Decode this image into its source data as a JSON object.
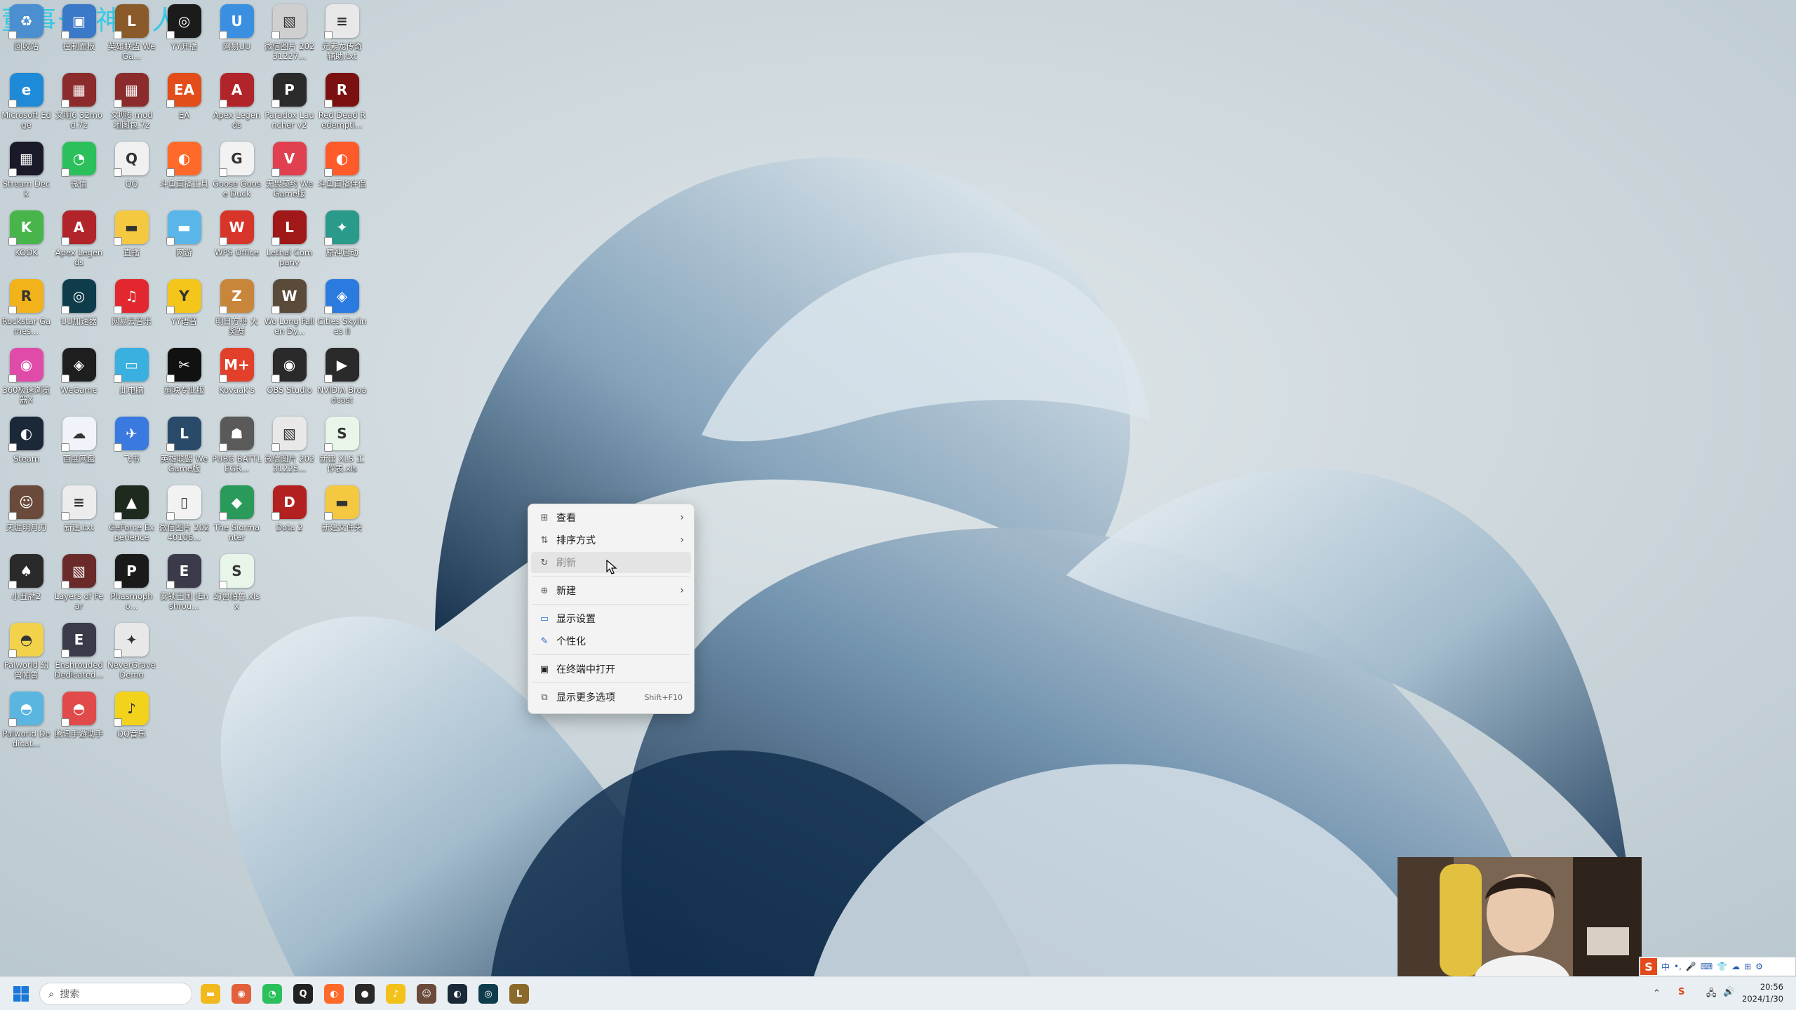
{
  "watermark": {
    "text": "董事长 神秘人"
  },
  "desktop": {
    "icons": [
      {
        "label": "回收站",
        "glyph": "♻",
        "color": "#4b8fd1"
      },
      {
        "label": "控制面板",
        "glyph": "▣",
        "color": "#3a78c8"
      },
      {
        "label": "英雄联盟 WeGa...",
        "glyph": "L",
        "color": "#8a5a2a"
      },
      {
        "label": "YY开播",
        "glyph": "◎",
        "color": "#1b1b1b"
      },
      {
        "label": "网易UU",
        "glyph": "U",
        "color": "#3a8fe0"
      },
      {
        "label": "微信图片 20231227...",
        "glyph": "▧",
        "color": "#cfcfcf"
      },
      {
        "label": "元素龙传奇 辅助.txt",
        "glyph": "≡",
        "color": "#e8e8e8"
      },
      {
        "label": "Microsoft Edge",
        "glyph": "e",
        "color": "#1f8ad8"
      },
      {
        "label": "文明6 32mod.7z",
        "glyph": "▦",
        "color": "#8b2b2b"
      },
      {
        "label": "文明6 mod 地图包.7z",
        "glyph": "▦",
        "color": "#8b2b2b"
      },
      {
        "label": "EA",
        "glyph": "EA",
        "color": "#e24d1a"
      },
      {
        "label": "Apex Legends",
        "glyph": "A",
        "color": "#b0242a"
      },
      {
        "label": "Paradox Launcher v2",
        "glyph": "P",
        "color": "#2b2b2b"
      },
      {
        "label": "Red Dead Redempti...",
        "glyph": "R",
        "color": "#7a1010"
      },
      {
        "label": "Stream Deck",
        "glyph": "▦",
        "color": "#1a1a2a"
      },
      {
        "label": "微信",
        "glyph": "◔",
        "color": "#2cc05c"
      },
      {
        "label": "QQ",
        "glyph": "Q",
        "color": "#f0f0f0"
      },
      {
        "label": "斗鱼直播工具",
        "glyph": "◐",
        "color": "#ff6a2a"
      },
      {
        "label": "Goose Goose Duck",
        "glyph": "G",
        "color": "#f2f2f2"
      },
      {
        "label": "无畏契约 WeGame版",
        "glyph": "V",
        "color": "#e04050"
      },
      {
        "label": "斗鱼直播伴侣",
        "glyph": "◐",
        "color": "#ff5a2a"
      },
      {
        "label": "KOOK",
        "glyph": "K",
        "color": "#47b54a"
      },
      {
        "label": "Apex Legends",
        "glyph": "A",
        "color": "#b0242a"
      },
      {
        "label": "直播",
        "glyph": "▬",
        "color": "#f5c842"
      },
      {
        "label": "网游",
        "glyph": "▬",
        "color": "#5ab6e8"
      },
      {
        "label": "WPS Office",
        "glyph": "W",
        "color": "#d8352a"
      },
      {
        "label": "Lethal Company",
        "glyph": "L",
        "color": "#a01818"
      },
      {
        "label": "原神启动",
        "glyph": "✦",
        "color": "#2a9a8a"
      },
      {
        "label": "Rockstar Games...",
        "glyph": "R",
        "color": "#f2b21b"
      },
      {
        "label": "UU加速器",
        "glyph": "◎",
        "color": "#0e3c4a"
      },
      {
        "label": "网易云音乐",
        "glyph": "♫",
        "color": "#e2282e"
      },
      {
        "label": "YY语音",
        "glyph": "Y",
        "color": "#f4c51a"
      },
      {
        "label": "明日方舟 大奖赛",
        "glyph": "Z",
        "color": "#c8863a"
      },
      {
        "label": "Wo Long Fallen Dy...",
        "glyph": "W",
        "color": "#5a4a3a"
      },
      {
        "label": "Cities Skylines II",
        "glyph": "◈",
        "color": "#2a7ae0"
      },
      {
        "label": "360极速浏览器X",
        "glyph": "◉",
        "color": "#e04aa8"
      },
      {
        "label": "WeGame",
        "glyph": "◈",
        "color": "#1e1e1e"
      },
      {
        "label": "此电脑",
        "glyph": "▭",
        "color": "#3ab0e0"
      },
      {
        "label": "剪映专业版",
        "glyph": "✂",
        "color": "#111111"
      },
      {
        "label": "Kovaak's",
        "glyph": "M+",
        "color": "#e2402a"
      },
      {
        "label": "OBS Studio",
        "glyph": "◉",
        "color": "#2a2a2a"
      },
      {
        "label": "NVIDIA Broadcast",
        "glyph": "▶",
        "color": "#2a2a2a"
      },
      {
        "label": "Steam",
        "glyph": "◐",
        "color": "#1b2838"
      },
      {
        "label": "百度网盘",
        "glyph": "☁",
        "color": "#f0f4fa"
      },
      {
        "label": "飞书",
        "glyph": "✈",
        "color": "#3a7ae0"
      },
      {
        "label": "英雄联盟 WeGame版",
        "glyph": "L",
        "color": "#2a4a6a"
      },
      {
        "label": "PUBG BATTLEGR...",
        "glyph": "☗",
        "color": "#5a5a5a"
      },
      {
        "label": "微信图片 20231225...",
        "glyph": "▧",
        "color": "#e8e8e8"
      },
      {
        "label": "新建 XLS 工作表.xls",
        "glyph": "S",
        "color": "#e8f6ea"
      },
      {
        "label": "天涯明月刀",
        "glyph": "☺",
        "color": "#6a4a3a"
      },
      {
        "label": "新建.txt",
        "glyph": "≡",
        "color": "#ececec"
      },
      {
        "label": "GeForce Experience",
        "glyph": "▲",
        "color": "#1f2a1f"
      },
      {
        "label": "微信图片 20240106...",
        "glyph": "▯",
        "color": "#f2f2f2"
      },
      {
        "label": "The Siormanter",
        "glyph": "◆",
        "color": "#2a9a5a"
      },
      {
        "label": "Dota 2",
        "glyph": "D",
        "color": "#b22020"
      },
      {
        "label": "新建文件夹",
        "glyph": "▬",
        "color": "#f5c842"
      },
      {
        "label": "小丑牌2",
        "glyph": "♠",
        "color": "#2a2a2a"
      },
      {
        "label": "Layers of Fear",
        "glyph": "▧",
        "color": "#6a2a2a"
      },
      {
        "label": "Phasmopho...",
        "glyph": "P",
        "color": "#1a1a1a"
      },
      {
        "label": "雾锁王国 (Enshrou...",
        "glyph": "E",
        "color": "#3a3a4a"
      },
      {
        "label": "幻兽帕鲁.xlsx",
        "glyph": "S",
        "color": "#e8f6ea"
      },
      {
        "label": "",
        "glyph": "",
        "color": "transparent"
      },
      {
        "label": "",
        "glyph": "",
        "color": "transparent"
      },
      {
        "label": "Palworld 幻兽帕鲁",
        "glyph": "◓",
        "color": "#f2d24a"
      },
      {
        "label": "Enshrouded Dedicated...",
        "glyph": "E",
        "color": "#3a3a4a"
      },
      {
        "label": "NeverGrave Demo",
        "glyph": "✦",
        "color": "#e8e8e8"
      },
      {
        "label": "",
        "glyph": "",
        "color": "transparent"
      },
      {
        "label": "",
        "glyph": "",
        "color": "transparent"
      },
      {
        "label": "",
        "glyph": "",
        "color": "transparent"
      },
      {
        "label": "",
        "glyph": "",
        "color": "transparent"
      },
      {
        "label": "Palworld Dedicat...",
        "glyph": "◓",
        "color": "#5ab6e0"
      },
      {
        "label": "腾讯手游助手",
        "glyph": "◓",
        "color": "#e04a4a"
      },
      {
        "label": "QQ音乐",
        "glyph": "♪",
        "color": "#f2d21a"
      }
    ]
  },
  "context_menu": {
    "items": [
      {
        "label": "查看",
        "icon": "grid-icon",
        "glyph": "⊞",
        "arrow": "›"
      },
      {
        "label": "排序方式",
        "icon": "sort-icon",
        "glyph": "⇅",
        "arrow": "›"
      },
      {
        "label": "刷新",
        "icon": "refresh-icon",
        "glyph": "↻",
        "disabled": true
      },
      {
        "label": "新建",
        "icon": "new-icon",
        "glyph": "⊕",
        "arrow": "›"
      },
      {
        "label": "显示设置",
        "icon": "display-settings-icon",
        "glyph": "▭"
      },
      {
        "label": "个性化",
        "icon": "personalize-icon",
        "glyph": "✎"
      },
      {
        "label": "在终端中打开",
        "icon": "terminal-icon",
        "glyph": "▣"
      },
      {
        "label": "显示更多选项",
        "icon": "more-options-icon",
        "glyph": "⧉",
        "accel": "Shift+F10"
      }
    ]
  },
  "taskbar": {
    "search_placeholder": "搜索",
    "apps": [
      {
        "name": "file-explorer",
        "glyph": "▬",
        "color": "#f2b91e"
      },
      {
        "name": "360-browser",
        "glyph": "◉",
        "color": "#e2603a"
      },
      {
        "name": "wechat",
        "glyph": "◔",
        "color": "#2cc05c"
      },
      {
        "name": "qq",
        "glyph": "Q",
        "color": "#222222"
      },
      {
        "name": "douyu",
        "glyph": "◐",
        "color": "#ff6a2a"
      },
      {
        "name": "obs-record",
        "glyph": "●",
        "color": "#2a2a2a"
      },
      {
        "name": "qq-music",
        "glyph": "♪",
        "color": "#f2c21a"
      },
      {
        "name": "avatar-app",
        "glyph": "☺",
        "color": "#6a4a3a"
      },
      {
        "name": "steam",
        "glyph": "◐",
        "color": "#1b2838"
      },
      {
        "name": "uu-booster",
        "glyph": "◎",
        "color": "#0e3c4a"
      },
      {
        "name": "lol",
        "glyph": "L",
        "color": "#8a6a2a"
      }
    ],
    "clock": {
      "time": "20:56",
      "date": "2024/1/30"
    },
    "ime": {
      "items": [
        "中",
        "•,",
        "🎤",
        "⌨",
        "👕",
        "☁",
        "⊞",
        "⚙"
      ]
    }
  }
}
